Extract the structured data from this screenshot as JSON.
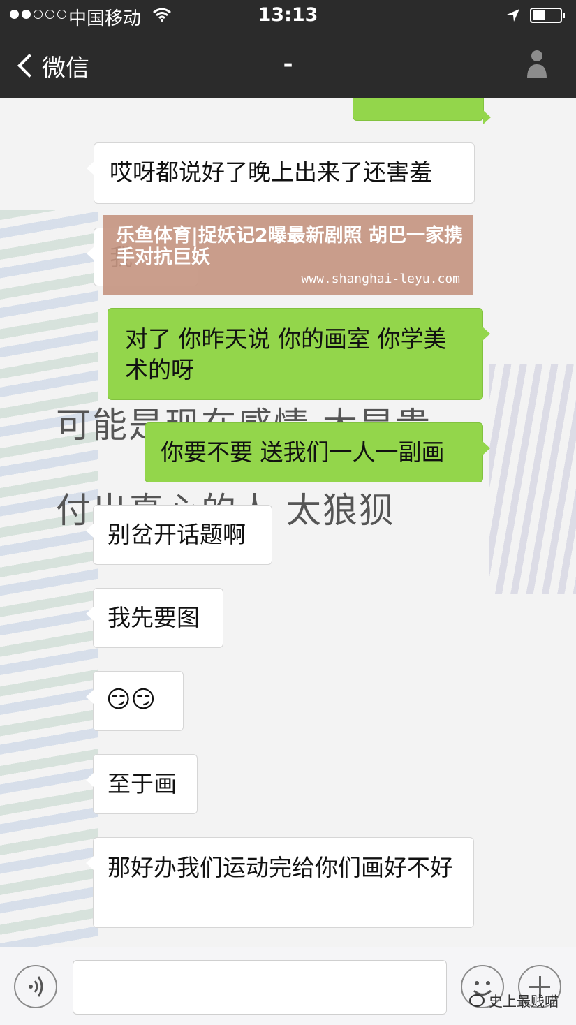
{
  "status_bar": {
    "carrier": "中国移动",
    "time": "13:13",
    "signal_bars_filled": 2,
    "signal_bars_total": 5
  },
  "nav": {
    "back_label": "微信",
    "title": "-"
  },
  "background_text": {
    "line1": "可能是现在感情 太昂贵",
    "line2": "付出真心的人 太狼狈"
  },
  "messages": [
    {
      "side": "out",
      "text": "  "
    },
    {
      "side": "in",
      "text": "哎呀都说好了晚上出来了还害羞"
    },
    {
      "side": "in",
      "text": "我"
    },
    {
      "side": "out",
      "text": "对了 你昨天说 你的画室 你学美术的呀"
    },
    {
      "side": "out",
      "text": "你要不要 送我们一人一副画"
    },
    {
      "side": "in",
      "text": "别岔开话题啊"
    },
    {
      "side": "in",
      "text": "我先要图"
    },
    {
      "side": "in",
      "text": "😏😏"
    },
    {
      "side": "in",
      "text": "至于画"
    },
    {
      "side": "in",
      "text": "那好办我们运动完给你们画好不好"
    }
  ],
  "watermark": {
    "title": "乐鱼体育|捉妖记2曝最新剧照 胡巴一家携手对抗巨妖",
    "url": "www.shanghai-leyu.com"
  },
  "input_bar": {
    "value": "",
    "voice_icon": "voice-icon",
    "emoji_icon": "emoji-icon",
    "plus_icon": "plus-icon"
  },
  "corner_watermark": "史上最贱喵",
  "colors": {
    "header": "#2b2b2b",
    "chat_bg": "#f3f3f3",
    "out_bubble": "#93d64b",
    "in_bubble": "#ffffff"
  }
}
